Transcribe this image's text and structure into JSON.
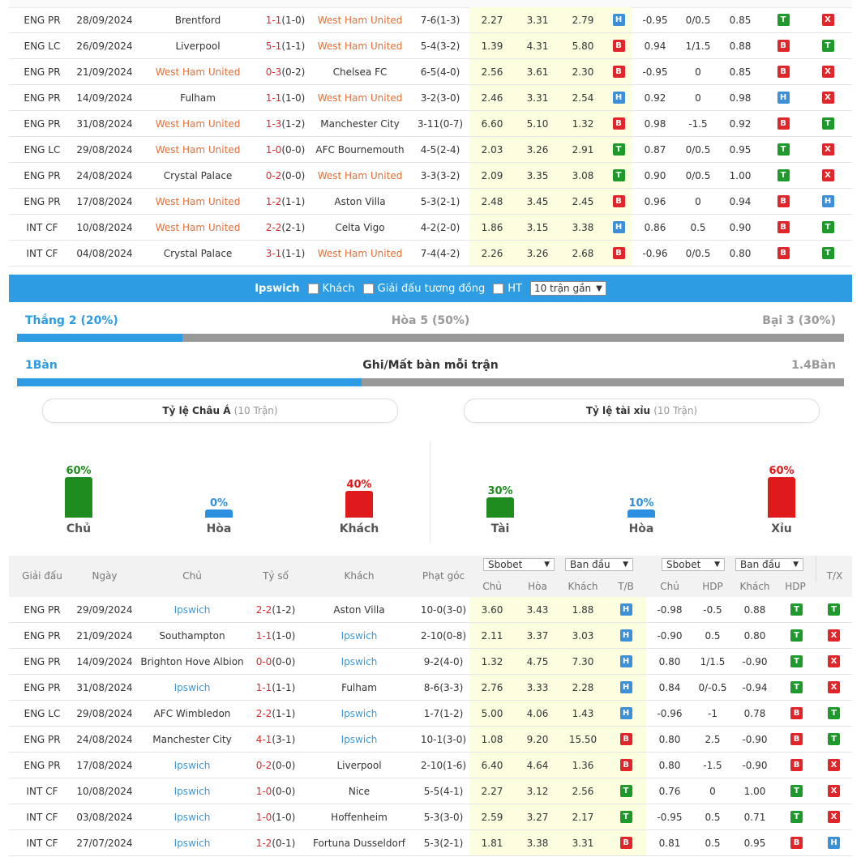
{
  "table1": {
    "rows": [
      {
        "league": "ENG PR",
        "date": "28/09/2024",
        "home": "Brentford",
        "score_ft": "1-1",
        "score_ht": "(1-0)",
        "away": "West Ham United",
        "corner": "7-6(1-3)",
        "o_home": "2.27",
        "o_draw": "3.31",
        "o_away": "2.79",
        "tb1": "H",
        "ah_home": "-0.95",
        "hdp": "0/0.5",
        "ah_away": "0.85",
        "tb2": "T",
        "tx": "X",
        "hl": "away",
        "sc": "red"
      },
      {
        "league": "ENG LC",
        "date": "26/09/2024",
        "home": "Liverpool",
        "score_ft": "5-1",
        "score_ht": "(1-1)",
        "away": "West Ham United",
        "corner": "5-4(3-2)",
        "o_home": "1.39",
        "o_draw": "4.31",
        "o_away": "5.80",
        "tb1": "B",
        "ah_home": "0.94",
        "hdp": "1/1.5",
        "ah_away": "0.88",
        "tb2": "B",
        "tx": "T",
        "hl": "away",
        "sc": "red"
      },
      {
        "league": "ENG PR",
        "date": "21/09/2024",
        "home": "West Ham United",
        "score_ft": "0-3",
        "score_ht": "(0-2)",
        "away": "Chelsea FC",
        "corner": "6-5(4-0)",
        "o_home": "2.56",
        "o_draw": "3.61",
        "o_away": "2.30",
        "tb1": "B",
        "ah_home": "-0.95",
        "hdp": "0",
        "ah_away": "0.85",
        "tb2": "B",
        "tx": "X",
        "hl": "home",
        "sc": "red"
      },
      {
        "league": "ENG PR",
        "date": "14/09/2024",
        "home": "Fulham",
        "score_ft": "1-1",
        "score_ht": "(1-0)",
        "away": "West Ham United",
        "corner": "3-2(3-0)",
        "o_home": "2.46",
        "o_draw": "3.31",
        "o_away": "2.54",
        "tb1": "H",
        "ah_home": "0.92",
        "hdp": "0",
        "ah_away": "0.98",
        "tb2": "H",
        "tx": "X",
        "hl": "away",
        "sc": "red"
      },
      {
        "league": "ENG PR",
        "date": "31/08/2024",
        "home": "West Ham United",
        "score_ft": "1-3",
        "score_ht": "(1-2)",
        "away": "Manchester City",
        "corner": "3-11(0-7)",
        "o_home": "6.60",
        "o_draw": "5.10",
        "o_away": "1.32",
        "tb1": "B",
        "ah_home": "0.98",
        "hdp": "-1.5",
        "ah_away": "0.92",
        "tb2": "B",
        "tx": "T",
        "hl": "home",
        "sc": "red"
      },
      {
        "league": "ENG LC",
        "date": "29/08/2024",
        "home": "West Ham United",
        "score_ft": "1-0",
        "score_ht": "(0-0)",
        "away": "AFC Bournemouth",
        "corner": "4-5(2-4)",
        "o_home": "2.03",
        "o_draw": "3.26",
        "o_away": "2.91",
        "tb1": "T",
        "ah_home": "0.87",
        "hdp": "0/0.5",
        "ah_away": "0.95",
        "tb2": "T",
        "tx": "X",
        "hl": "home",
        "sc": "red"
      },
      {
        "league": "ENG PR",
        "date": "24/08/2024",
        "home": "Crystal Palace",
        "score_ft": "0-2",
        "score_ht": "(0-0)",
        "away": "West Ham United",
        "corner": "3-3(3-2)",
        "o_home": "2.09",
        "o_draw": "3.35",
        "o_away": "3.08",
        "tb1": "T",
        "ah_home": "0.90",
        "hdp": "0/0.5",
        "ah_away": "1.00",
        "tb2": "T",
        "tx": "X",
        "hl": "away",
        "sc": "red"
      },
      {
        "league": "ENG PR",
        "date": "17/08/2024",
        "home": "West Ham United",
        "score_ft": "1-2",
        "score_ht": "(1-1)",
        "away": "Aston Villa",
        "corner": "5-3(2-1)",
        "o_home": "2.48",
        "o_draw": "3.45",
        "o_away": "2.45",
        "tb1": "B",
        "ah_home": "0.96",
        "hdp": "0",
        "ah_away": "0.94",
        "tb2": "B",
        "tx": "H",
        "hl": "home",
        "sc": "red"
      },
      {
        "league": "INT CF",
        "date": "10/08/2024",
        "home": "West Ham United",
        "score_ft": "2-2",
        "score_ht": "(2-1)",
        "away": "Celta Vigo",
        "corner": "4-2(2-0)",
        "o_home": "1.86",
        "o_draw": "3.15",
        "o_away": "3.38",
        "tb1": "H",
        "ah_home": "0.86",
        "hdp": "0.5",
        "ah_away": "0.90",
        "tb2": "B",
        "tx": "T",
        "hl": "home",
        "sc": "red"
      },
      {
        "league": "INT CF",
        "date": "04/08/2024",
        "home": "Crystal Palace",
        "score_ft": "3-1",
        "score_ht": "(1-1)",
        "away": "West Ham United",
        "corner": "7-4(4-2)",
        "o_home": "2.26",
        "o_draw": "3.26",
        "o_away": "2.68",
        "tb1": "B",
        "ah_home": "-0.96",
        "hdp": "0/0.5",
        "ah_away": "0.80",
        "tb2": "B",
        "tx": "T",
        "hl": "away",
        "sc": "red"
      }
    ]
  },
  "filter": {
    "team": "Ipswich",
    "opt_away": "Khách",
    "opt_same_league": "Giải đấu tương đồng",
    "opt_ht": "HT",
    "select_value": "10 trận gần"
  },
  "summary": {
    "win": "Thắng 2 (20%)",
    "draw": "Hòa 5 (50%)",
    "loss": "Bại 3 (30%)",
    "win_fraction": 0.2,
    "goals_for": "1Bàn",
    "goals_title": "Ghi/Mất bàn mỗi trận",
    "goals_against": "1.4Bàn",
    "goals_fraction": 0.417
  },
  "asian": {
    "title": "Tỷ lệ Châu Á",
    "count": "(10 Trận)",
    "bars": [
      {
        "pct": "60%",
        "label": "Chủ",
        "value": 60,
        "color": "#1e8c1e"
      },
      {
        "pct": "0%",
        "label": "Hòa",
        "value": 0,
        "color": "#2d8fe0"
      },
      {
        "pct": "40%",
        "label": "Khách",
        "value": 40,
        "color": "#e01a1a"
      }
    ]
  },
  "overunder": {
    "title": "Tỷ lệ tài xỉu",
    "count": "(10 Trận)",
    "bars": [
      {
        "pct": "30%",
        "label": "Tài",
        "value": 30,
        "color": "#1e8c1e"
      },
      {
        "pct": "10%",
        "label": "Hòa",
        "value": 10,
        "color": "#2d8fe0"
      },
      {
        "pct": "60%",
        "label": "Xỉu",
        "value": 60,
        "color": "#e01a1a"
      }
    ]
  },
  "table2": {
    "headers": {
      "league": "Giải đấu",
      "date": "Ngày",
      "home": "Chủ",
      "score": "Tỷ số",
      "away": "Khách",
      "corner": "Phạt góc",
      "dd1": "Sbobet",
      "dd2": "Ban đầu",
      "dd3": "Sbobet",
      "dd4": "Ban đầu",
      "h_home": "Chủ",
      "h_draw": "Hòa",
      "h_away": "Khách",
      "h_tb": "T/B",
      "h_ah_home": "Chủ",
      "h_hdp": "HDP",
      "h_ah_away": "Khách",
      "h_hdp2": "HDP",
      "h_tx": "T/X"
    },
    "rows": [
      {
        "league": "ENG PR",
        "date": "29/09/2024",
        "home": "Ipswich",
        "score_ft": "2-2",
        "score_ht": "(1-2)",
        "away": "Aston Villa",
        "corner": "10-0(3-0)",
        "o_home": "3.60",
        "o_draw": "3.43",
        "o_away": "1.88",
        "tb1": "H",
        "ah_home": "-0.98",
        "hdp": "-0.5",
        "ah_away": "0.88",
        "tb2": "T",
        "tx": "T",
        "hl": "home",
        "sc": "red"
      },
      {
        "league": "ENG PR",
        "date": "21/09/2024",
        "home": "Southampton",
        "score_ft": "1-1",
        "score_ht": "(1-0)",
        "away": "Ipswich",
        "corner": "2-10(0-8)",
        "o_home": "2.11",
        "o_draw": "3.37",
        "o_away": "3.03",
        "tb1": "H",
        "ah_home": "-0.90",
        "hdp": "0.5",
        "ah_away": "0.80",
        "tb2": "T",
        "tx": "X",
        "hl": "away",
        "sc": "red"
      },
      {
        "league": "ENG PR",
        "date": "14/09/2024",
        "home": "Brighton Hove Albion",
        "score_ft": "0-0",
        "score_ht": "(0-0)",
        "away": "Ipswich",
        "corner": "9-2(4-0)",
        "o_home": "1.32",
        "o_draw": "4.75",
        "o_away": "7.30",
        "tb1": "H",
        "ah_home": "0.80",
        "hdp": "1/1.5",
        "ah_away": "-0.90",
        "tb2": "T",
        "tx": "X",
        "hl": "away",
        "sc": "red"
      },
      {
        "league": "ENG PR",
        "date": "31/08/2024",
        "home": "Ipswich",
        "score_ft": "1-1",
        "score_ht": "(1-1)",
        "away": "Fulham",
        "corner": "8-6(3-3)",
        "o_home": "2.76",
        "o_draw": "3.33",
        "o_away": "2.28",
        "tb1": "H",
        "ah_home": "0.84",
        "hdp": "0/-0.5",
        "ah_away": "-0.94",
        "tb2": "T",
        "tx": "X",
        "hl": "home",
        "sc": "red"
      },
      {
        "league": "ENG LC",
        "date": "29/08/2024",
        "home": "AFC Wimbledon",
        "score_ft": "2-2",
        "score_ht": "(1-1)",
        "away": "Ipswich",
        "corner": "1-7(1-2)",
        "o_home": "5.00",
        "o_draw": "4.06",
        "o_away": "1.43",
        "tb1": "H",
        "ah_home": "-0.96",
        "hdp": "-1",
        "ah_away": "0.78",
        "tb2": "B",
        "tx": "T",
        "hl": "away",
        "sc": "red"
      },
      {
        "league": "ENG PR",
        "date": "24/08/2024",
        "home": "Manchester City",
        "score_ft": "4-1",
        "score_ht": "(3-1)",
        "away": "Ipswich",
        "corner": "10-1(3-0)",
        "o_home": "1.08",
        "o_draw": "9.20",
        "o_away": "15.50",
        "tb1": "B",
        "ah_home": "0.80",
        "hdp": "2.5",
        "ah_away": "-0.90",
        "tb2": "B",
        "tx": "T",
        "hl": "away",
        "sc": "red"
      },
      {
        "league": "ENG PR",
        "date": "17/08/2024",
        "home": "Ipswich",
        "score_ft": "0-2",
        "score_ht": "(0-0)",
        "away": "Liverpool",
        "corner": "2-10(1-6)",
        "o_home": "6.40",
        "o_draw": "4.64",
        "o_away": "1.36",
        "tb1": "B",
        "ah_home": "0.80",
        "hdp": "-1.5",
        "ah_away": "-0.90",
        "tb2": "B",
        "tx": "X",
        "hl": "home",
        "sc": "red"
      },
      {
        "league": "INT CF",
        "date": "10/08/2024",
        "home": "Ipswich",
        "score_ft": "1-0",
        "score_ht": "(0-0)",
        "away": "Nice",
        "corner": "5-5(4-1)",
        "o_home": "2.27",
        "o_draw": "3.12",
        "o_away": "2.56",
        "tb1": "T",
        "ah_home": "0.76",
        "hdp": "0",
        "ah_away": "1.00",
        "tb2": "T",
        "tx": "X",
        "hl": "home",
        "sc": "red"
      },
      {
        "league": "INT CF",
        "date": "03/08/2024",
        "home": "Ipswich",
        "score_ft": "1-0",
        "score_ht": "(1-0)",
        "away": "Hoffenheim",
        "corner": "5-3(3-0)",
        "o_home": "2.59",
        "o_draw": "3.27",
        "o_away": "2.17",
        "tb1": "T",
        "ah_home": "-0.95",
        "hdp": "0.5",
        "ah_away": "0.71",
        "tb2": "T",
        "tx": "X",
        "hl": "home",
        "sc": "red"
      },
      {
        "league": "INT CF",
        "date": "27/07/2024",
        "home": "Ipswich",
        "score_ft": "1-2",
        "score_ht": "(0-1)",
        "away": "Fortuna Dusseldorf",
        "corner": "5-3(2-1)",
        "o_home": "1.81",
        "o_draw": "3.38",
        "o_away": "3.31",
        "tb1": "B",
        "ah_home": "0.81",
        "hdp": "0.5",
        "ah_away": "0.95",
        "tb2": "B",
        "tx": "H",
        "hl": "home",
        "sc": "red"
      }
    ]
  }
}
